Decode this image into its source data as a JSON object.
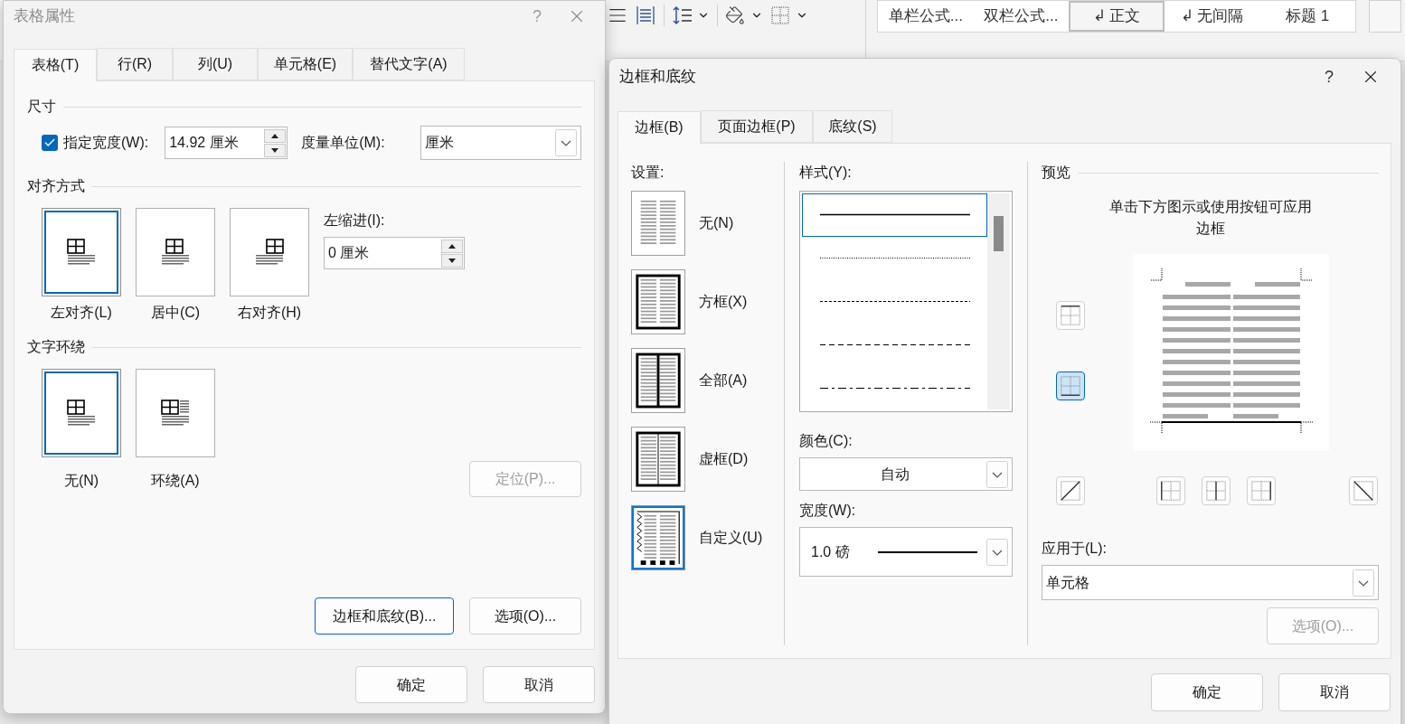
{
  "ribbon": {
    "styles": [
      {
        "label": "单栏公式...",
        "selected": false
      },
      {
        "label": "双栏公式...",
        "selected": false
      },
      {
        "label": "↲ 正文",
        "selected": true
      },
      {
        "label": "↲ 无间隔",
        "selected": false
      },
      {
        "label": "标题 1",
        "selected": false
      }
    ]
  },
  "table_properties": {
    "title": "表格属性",
    "active": false,
    "help": "?",
    "tabs": [
      {
        "label": "表格(T)",
        "selected": true
      },
      {
        "label": "行(R)",
        "selected": false
      },
      {
        "label": "列(U)",
        "selected": false
      },
      {
        "label": "单元格(E)",
        "selected": false
      },
      {
        "label": "替代文字(A)",
        "selected": false
      }
    ],
    "size": {
      "heading": "尺寸",
      "width_checkbox": {
        "label": "指定宽度(W):",
        "checked": true
      },
      "width_value": "14.92 厘米",
      "unit_label": "度量单位(M):",
      "unit_value": "厘米"
    },
    "alignment": {
      "heading": "对齐方式",
      "indent_label": "左缩进(I):",
      "indent_value": "0 厘米",
      "options": [
        {
          "kind": "left",
          "label": "左对齐(L)",
          "selected": true
        },
        {
          "kind": "center",
          "label": "居中(C)",
          "selected": false
        },
        {
          "kind": "right",
          "label": "右对齐(H)",
          "selected": false
        }
      ]
    },
    "wrapping": {
      "heading": "文字环绕",
      "position_button": {
        "label": "定位(P)...",
        "disabled": true
      },
      "options": [
        {
          "kind": "none",
          "label": "无(N)",
          "selected": true
        },
        {
          "kind": "around",
          "label": "环绕(A)",
          "selected": false
        }
      ]
    },
    "buttons": [
      {
        "label": "边框和底纹(B)...",
        "default": true
      },
      {
        "label": "选项(O)...",
        "default": false
      }
    ],
    "footer": [
      "确定",
      "取消"
    ]
  },
  "borders_and_shading": {
    "title": "边框和底纹",
    "active": true,
    "help": "?",
    "tabs": [
      {
        "label": "边框(B)",
        "selected": true
      },
      {
        "label": "页面边框(P)",
        "selected": false
      },
      {
        "label": "底纹(S)",
        "selected": false
      }
    ],
    "settings": {
      "heading": "设置:",
      "options": [
        {
          "kind": "none",
          "label": "无(N)",
          "selected": false
        },
        {
          "kind": "box",
          "label": "方框(X)",
          "selected": false
        },
        {
          "kind": "all",
          "label": "全部(A)",
          "selected": false
        },
        {
          "kind": "grid",
          "label": "虚框(D)",
          "selected": false
        },
        {
          "kind": "custom",
          "label": "自定义(U)",
          "selected": true
        }
      ]
    },
    "style": {
      "heading": "样式(Y):",
      "lines": [
        {
          "kind": "solid",
          "selected": true
        },
        {
          "kind": "dotted",
          "selected": false
        },
        {
          "kind": "dashed_fine",
          "selected": false
        },
        {
          "kind": "dashed",
          "selected": false
        },
        {
          "kind": "dash_dot",
          "selected": false
        }
      ],
      "color_label": "颜色(C):",
      "color_value": "自动",
      "width_label": "宽度(W):",
      "width_value": "1.0 磅"
    },
    "preview": {
      "heading": "预览",
      "instruction": "单击下方图示或使用按钮可应用边框",
      "border_buttons": [
        {
          "kind": "top",
          "selected": false
        },
        {
          "kind": "bottom",
          "selected": true
        },
        {
          "kind": "diag_up",
          "selected": false
        },
        {
          "kind": "left",
          "selected": false
        },
        {
          "kind": "inside_v",
          "selected": false
        },
        {
          "kind": "right",
          "selected": false
        },
        {
          "kind": "diag_down",
          "selected": false
        }
      ],
      "apply_label": "应用于(L):",
      "apply_value": "单元格",
      "options_button": {
        "label": "选项(O)...",
        "disabled": true
      }
    },
    "footer": [
      "确定",
      "取消"
    ]
  }
}
